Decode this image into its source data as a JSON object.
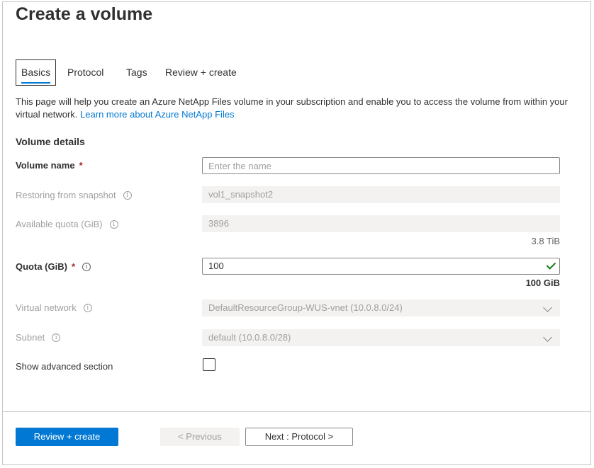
{
  "page": {
    "title": "Create a volume"
  },
  "tabs": [
    {
      "label": "Basics",
      "active": true
    },
    {
      "label": "Protocol",
      "active": false
    },
    {
      "label": "Tags",
      "active": false
    },
    {
      "label": "Review + create",
      "active": false
    }
  ],
  "description": {
    "text": "This page will help you create an Azure NetApp Files volume in your subscription and enable you to access the volume from within your virtual network.",
    "link": "Learn more about Azure NetApp Files"
  },
  "section": {
    "title": "Volume details"
  },
  "fields": {
    "volume_name": {
      "label": "Volume name",
      "required_mark": "*",
      "value": "",
      "placeholder": "Enter the name"
    },
    "snapshot": {
      "label": "Restoring from snapshot",
      "value": "vol1_snapshot2"
    },
    "available_quota": {
      "label": "Available quota (GiB)",
      "value": "3896",
      "hint": "3.8 TiB"
    },
    "quota": {
      "label": "Quota (GiB)",
      "required_mark": "*",
      "value": "100",
      "hint": "100 GiB"
    },
    "virtual_network": {
      "label": "Virtual network",
      "value": "DefaultResourceGroup-WUS-vnet (10.0.8.0/24)"
    },
    "subnet": {
      "label": "Subnet",
      "value": "default (10.0.8.0/28)"
    },
    "advanced": {
      "label": "Show advanced section",
      "checked": false
    }
  },
  "footer": {
    "review_create": "Review + create",
    "previous": "< Previous",
    "next": "Next : Protocol >"
  },
  "colors": {
    "accent": "#0078d4",
    "required": "#a4262c",
    "valid": "#107c10"
  }
}
